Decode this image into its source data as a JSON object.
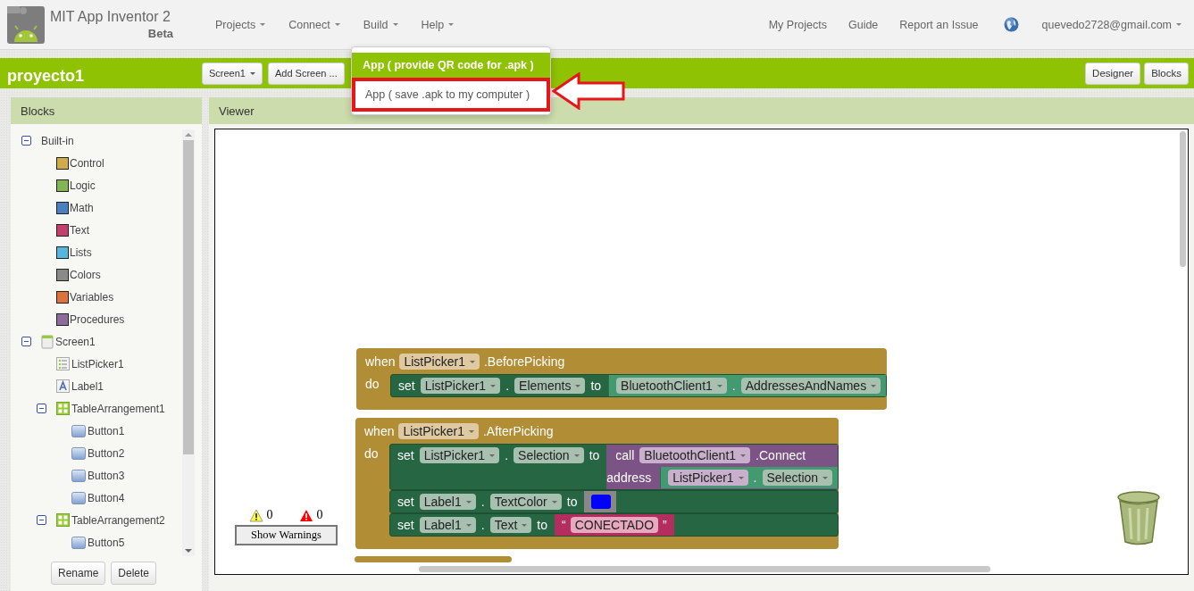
{
  "header": {
    "title": "MIT App Inventor 2",
    "subtitle": "Beta",
    "menus": [
      "Projects",
      "Connect",
      "Build",
      "Help"
    ],
    "links": [
      "My Projects",
      "Guide",
      "Report an Issue"
    ],
    "account": "quevedo2728@gmail.com"
  },
  "build_menu": {
    "items": [
      {
        "label": "App ( provide QR code for .apk )",
        "highlighted": true,
        "outlined": false
      },
      {
        "label": "App ( save .apk to my computer )",
        "highlighted": false,
        "outlined": true
      }
    ]
  },
  "project_bar": {
    "name": "proyecto1",
    "screen_button": "Screen1",
    "add_screen_button": "Add Screen ...",
    "view_buttons": [
      "Designer",
      "Blocks"
    ]
  },
  "blocks_panel": {
    "title": "Blocks",
    "tree": [
      {
        "label": "Built-in",
        "kind": "group",
        "expanded": true,
        "children": [
          {
            "label": "Control",
            "kind": "category",
            "color": "#d1aa4a"
          },
          {
            "label": "Logic",
            "kind": "category",
            "color": "#84b455"
          },
          {
            "label": "Math",
            "kind": "category",
            "color": "#4a80c0"
          },
          {
            "label": "Text",
            "kind": "category",
            "color": "#c33f6e"
          },
          {
            "label": "Lists",
            "kind": "category",
            "color": "#57b6de"
          },
          {
            "label": "Colors",
            "kind": "category",
            "color": "#8a8a8a"
          },
          {
            "label": "Variables",
            "kind": "category",
            "color": "#dc723c"
          },
          {
            "label": "Procedures",
            "kind": "category",
            "color": "#8f6b9c"
          }
        ]
      },
      {
        "label": "Screen1",
        "kind": "screen",
        "expanded": true,
        "children": [
          {
            "label": "ListPicker1",
            "kind": "listpicker"
          },
          {
            "label": "Label1",
            "kind": "label"
          },
          {
            "label": "TableArrangement1",
            "kind": "table",
            "expanded": true,
            "children": [
              {
                "label": "Button1",
                "kind": "button"
              },
              {
                "label": "Button2",
                "kind": "button"
              },
              {
                "label": "Button3",
                "kind": "button"
              },
              {
                "label": "Button4",
                "kind": "button"
              }
            ]
          },
          {
            "label": "TableArrangement2",
            "kind": "table",
            "expanded": true,
            "children": [
              {
                "label": "Button5",
                "kind": "button"
              }
            ]
          }
        ]
      }
    ],
    "buttons": [
      "Rename",
      "Delete"
    ]
  },
  "viewer": {
    "title": "Viewer",
    "warnings_count": "0",
    "errors_count": "0",
    "show_warnings_button": "Show Warnings",
    "events": [
      {
        "when": "when",
        "component": "ListPicker1",
        "event": ".BeforePicking",
        "do": "do",
        "statements": [
          {
            "set": "set",
            "component": "ListPicker1",
            "dot": ".",
            "property": "Elements",
            "to": "to",
            "value": {
              "kind": "getter",
              "component": "BluetoothClient1",
              "dot": ".",
              "property": "AddressesAndNames"
            }
          }
        ]
      },
      {
        "when": "when",
        "component": "ListPicker1",
        "event": ".AfterPicking",
        "do": "do",
        "statements": [
          {
            "set": "set",
            "component": "ListPicker1",
            "dot": ".",
            "property": "Selection",
            "to": "to",
            "value": {
              "kind": "call",
              "call": "call",
              "component": "BluetoothClient1",
              "method": ".Connect",
              "arg_label": "address",
              "arg": {
                "kind": "getter",
                "component": "ListPicker1",
                "dot": ".",
                "property": "Selection"
              }
            }
          },
          {
            "set": "set",
            "component": "Label1",
            "dot": ".",
            "property": "TextColor",
            "to": "to",
            "value": {
              "kind": "color",
              "color": "#0000ff"
            }
          },
          {
            "set": "set",
            "component": "Label1",
            "dot": ".",
            "property": "Text",
            "to": "to",
            "value": {
              "kind": "text",
              "open_quote": "“",
              "text": "CONECTADO",
              "close_quote": "”"
            }
          }
        ]
      }
    ]
  }
}
